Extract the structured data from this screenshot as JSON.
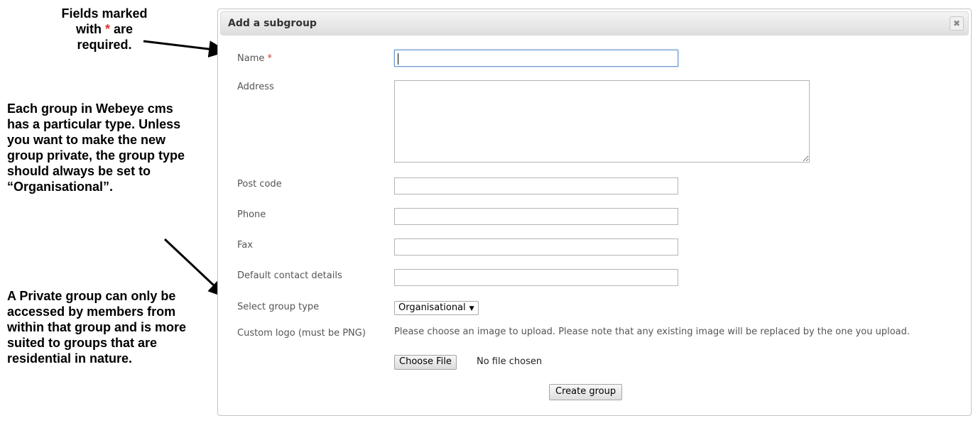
{
  "annotations": {
    "required_note": {
      "line1": "Fields marked",
      "line2_prefix": "with",
      "star": "*",
      "line2_suffix": "are",
      "line3": "required."
    },
    "group_type_note": "Each group in Webeye cms has a particular type. Unless you want to make the new group private, the group type should always be set to “Organisational”.",
    "private_note": "A Private group can only be accessed by members from within that group and is more suited to groups that are residential in nature."
  },
  "dialog": {
    "title": "Add a subgroup",
    "close_icon": "close-icon",
    "close_glyph": "✖",
    "fields": {
      "name": {
        "label": "Name",
        "required_star": "*",
        "value": ""
      },
      "address": {
        "label": "Address",
        "value": ""
      },
      "post_code": {
        "label": "Post code",
        "value": ""
      },
      "phone": {
        "label": "Phone",
        "value": ""
      },
      "fax": {
        "label": "Fax",
        "value": ""
      },
      "default_contact": {
        "label": "Default contact details",
        "value": ""
      },
      "group_type": {
        "label": "Select group type",
        "selected": "Organisational",
        "caret_glyph": "▼"
      },
      "custom_logo": {
        "label": "Custom logo (must be PNG)",
        "help": "Please choose an image to upload. Please note that any existing image will be replaced by the one you upload.",
        "button_label": "Choose File",
        "status": "No file chosen"
      }
    },
    "submit_label": "Create group"
  },
  "colors": {
    "required_star": "#e0312f",
    "focus_border": "#6b9bd2"
  }
}
